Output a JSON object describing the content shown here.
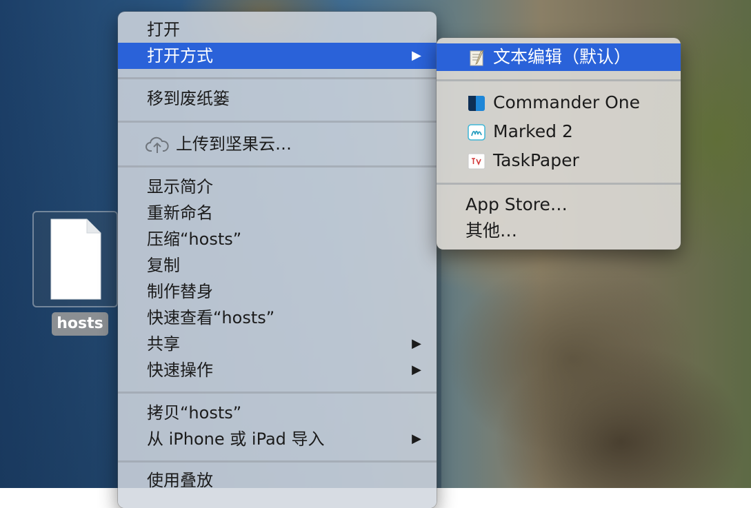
{
  "desktop": {
    "file_name": "hosts"
  },
  "context_menu": {
    "items": [
      {
        "label": "打开"
      },
      {
        "label": "打开方式",
        "has_submenu": true,
        "highlighted": true
      },
      {
        "label": "移到废纸篓"
      },
      {
        "label": "上传到坚果云…",
        "icon": "cloud-upload-icon"
      },
      {
        "label": "显示简介"
      },
      {
        "label": "重新命名"
      },
      {
        "label": "压缩“hosts”"
      },
      {
        "label": "复制"
      },
      {
        "label": "制作替身"
      },
      {
        "label": "快速查看“hosts”"
      },
      {
        "label": "共享",
        "has_submenu": true
      },
      {
        "label": "快速操作",
        "has_submenu": true
      },
      {
        "label": "拷贝“hosts”"
      },
      {
        "label": "从 iPhone 或 iPad 导入",
        "has_submenu": true
      },
      {
        "label": "使用叠放"
      }
    ],
    "submenu_arrow": "▶"
  },
  "open_with_submenu": {
    "items": [
      {
        "label": "文本编辑（默认）",
        "icon": "textedit-icon",
        "highlighted": true
      },
      {
        "label": "Commander One",
        "icon": "commander-one-icon"
      },
      {
        "label": "Marked 2",
        "icon": "marked-icon"
      },
      {
        "label": "TaskPaper",
        "icon": "taskpaper-icon"
      },
      {
        "label": "App Store…"
      },
      {
        "label": "其他…"
      }
    ]
  },
  "colors": {
    "highlight": "#2a62d9"
  }
}
